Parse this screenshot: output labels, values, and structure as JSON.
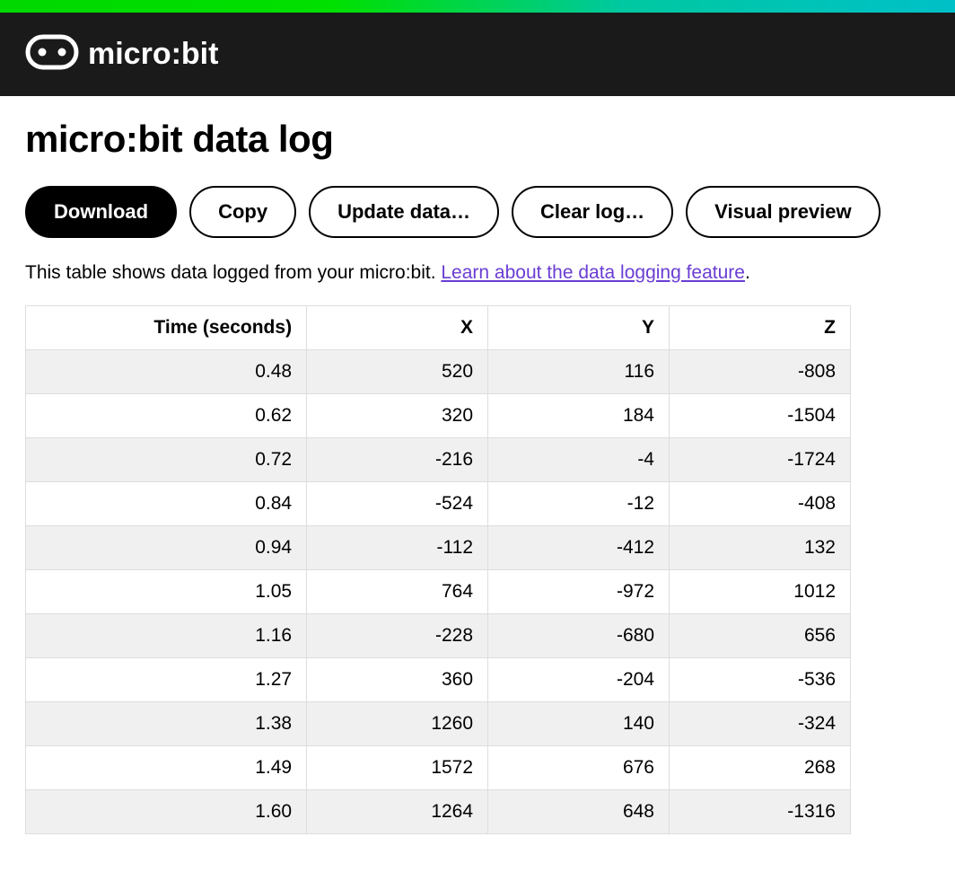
{
  "brand": {
    "name": "micro:bit"
  },
  "page": {
    "title": "micro:bit data log",
    "description_text": "This table shows data logged from your micro:bit. ",
    "link_text": "Learn about the data logging feature",
    "description_suffix": "."
  },
  "buttons": {
    "download": "Download",
    "copy": "Copy",
    "update": "Update data…",
    "clear": "Clear log…",
    "preview": "Visual preview"
  },
  "table": {
    "headers": [
      "Time (seconds)",
      "X",
      "Y",
      "Z"
    ],
    "rows": [
      [
        "0.48",
        "520",
        "116",
        "-808"
      ],
      [
        "0.62",
        "320",
        "184",
        "-1504"
      ],
      [
        "0.72",
        "-216",
        "-4",
        "-1724"
      ],
      [
        "0.84",
        "-524",
        "-12",
        "-408"
      ],
      [
        "0.94",
        "-112",
        "-412",
        "132"
      ],
      [
        "1.05",
        "764",
        "-972",
        "1012"
      ],
      [
        "1.16",
        "-228",
        "-680",
        "656"
      ],
      [
        "1.27",
        "360",
        "-204",
        "-536"
      ],
      [
        "1.38",
        "1260",
        "140",
        "-324"
      ],
      [
        "1.49",
        "1572",
        "676",
        "268"
      ],
      [
        "1.60",
        "1264",
        "648",
        "-1316"
      ]
    ]
  }
}
